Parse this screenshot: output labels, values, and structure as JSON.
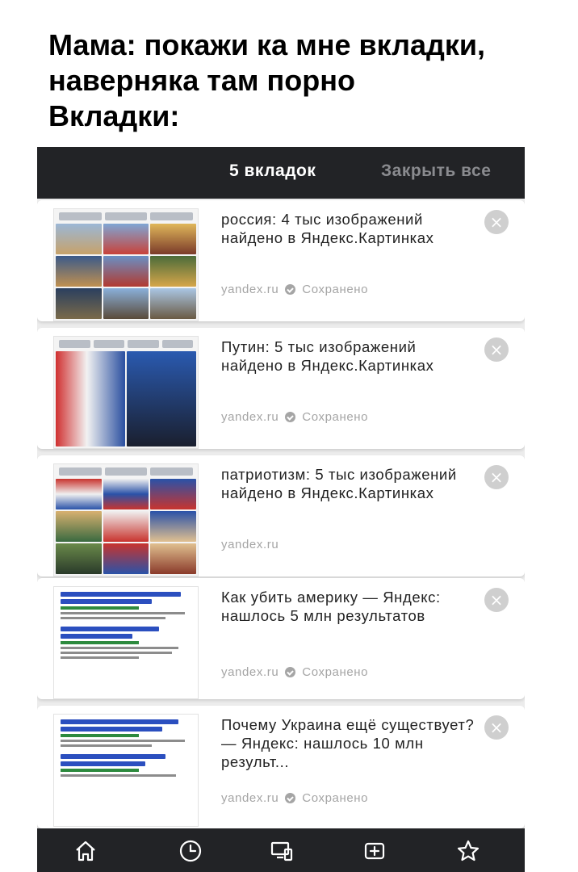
{
  "caption": {
    "line1": "Мама: покажи ка мне вкладки,",
    "line2": "наверняка там порно",
    "line3": "Вкладки:"
  },
  "topbar": {
    "tab_count": "5 вкладок",
    "close_all": "Закрыть все"
  },
  "tabs": [
    {
      "title": "россия: 4 тыс изображений найдено в Яндекс.Картинках",
      "domain": "yandex.ru",
      "status": "Сохранено"
    },
    {
      "title": "Путин: 5 тыс изображений найдено в Яндекс.Картинках",
      "domain": "yandex.ru",
      "status": "Сохранено"
    },
    {
      "title": "патриотизм: 5 тыс изображений найдено в Яндекс.Картинках",
      "domain": "yandex.ru",
      "status": ""
    },
    {
      "title": "Как убить америку — Яндекс: нашлось 5 млн результатов",
      "domain": "yandex.ru",
      "status": "Сохранено"
    },
    {
      "title": "Почему Украина ещё существует? — Яндекс: нашлось 10 млн результ...",
      "domain": "yandex.ru",
      "status": "Сохранено"
    }
  ],
  "bottom_nav": {
    "icons": [
      "home-icon",
      "history-icon",
      "devices-icon",
      "new-tab-icon",
      "bookmark-star-icon"
    ]
  },
  "colors": {
    "bar_bg": "#222326",
    "card_bg": "#ffffff",
    "meta_gray": "#a5a5a5",
    "close_all_gray": "#8a8b8f"
  }
}
